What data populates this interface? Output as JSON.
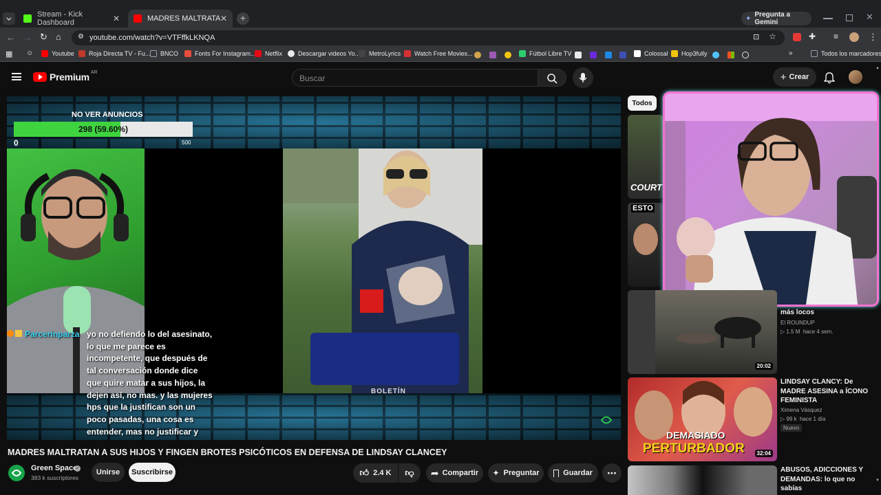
{
  "browser": {
    "tabs": [
      {
        "title": "Stream - Kick Dashboard",
        "active": false,
        "favicon_color": "#53fc18"
      },
      {
        "title": "MADRES MALTRATAN A SUS H",
        "active": true,
        "favicon_color": "#ff0000"
      }
    ],
    "gemini_label": "Pregunta a Gemini",
    "url": "youtube.com/watch?v=VTFffkLKNQA",
    "bookmarks": [
      {
        "label": "Youtube",
        "icon": "youtube-icon",
        "color": "#ff0000"
      },
      {
        "label": "Roja Directa TV - Fu...",
        "icon": "rojadirecta-icon",
        "color": "#c0392b"
      },
      {
        "label": "BNCO",
        "icon": "folder-icon",
        "color": "#9aa0a6"
      },
      {
        "label": "Fonts For Instagram...",
        "icon": "fonts-icon",
        "color": "#e74c3c"
      },
      {
        "label": "Netflix",
        "icon": "netflix-icon",
        "color": "#e50914"
      },
      {
        "label": "Descargar videos Yo...",
        "icon": "download-icon",
        "color": "#e8eaed"
      },
      {
        "label": "MetroLyrics",
        "icon": "metrolyrics-icon",
        "color": "#222222"
      },
      {
        "label": "Watch Free Movies...",
        "icon": "movies-icon",
        "color": "#d63031"
      },
      {
        "label": "Fútbol Libre TV",
        "icon": "futbol-icon",
        "color": "#2ecc71"
      },
      {
        "label": "Colossal",
        "icon": "colossal-icon",
        "color": "#ffffff"
      },
      {
        "label": "Hop3fully",
        "icon": "hop3fully-icon",
        "color": "#f1c40f"
      }
    ],
    "all_bookmarks_label": "Todos los marcadores"
  },
  "youtube": {
    "logo_text": "Premium",
    "region": "AR",
    "search_placeholder": "Buscar",
    "create_label": "Crear"
  },
  "stream_overlay": {
    "goal_title": "NO VER ANUNCIOS",
    "goal_value": "298 (59.60%)",
    "goal_fraction": 0.596,
    "goal_min": "0",
    "goal_max": "500",
    "chat_user": "Parcerinparza",
    "chat_message": "yo no defiendo lo del asesinato, lo que me parece es incompetente, que después de tal conversación donde dice que quire matar a sus hijos, la dejen así, no mas. y las mujeres hps que la justifican son un poco pasadas, una cosa es entender, mas no justificar y actuar con base a lo que hizo. entender, comprender no es justificar.",
    "lower_text": "BOLETÍN"
  },
  "video": {
    "title": "MADRES MALTRATAN A SUS HIJOS Y FINGEN BROTES PSICÓTICOS EN DEFENSA DE LINDSAY CLANCEY",
    "channel": "Green Space",
    "subscribers": "383 k suscriptores",
    "join_label": "Unirse",
    "subscribe_label": "Suscribirse",
    "likes": "2.4 K",
    "share_label": "Compartir",
    "ask_label": "Preguntar",
    "save_label": "Guardar"
  },
  "sidebar": {
    "chip_all": "Todos",
    "rec_partial_title": "más locos",
    "recommendations": [
      {
        "title": "",
        "channel": "El ROUNDUP",
        "views": "1.5 M",
        "age": "hace 4 sem.",
        "duration": "20:02",
        "thumb_text": ""
      },
      {
        "title": "LINDSAY CLANCY: De MADRE ASESINA a ÍCONO FEMINISTA",
        "channel": "Ximena Vásquez",
        "views": "99 k",
        "age": "hace 1 día",
        "badge": "Nuevo",
        "duration": "32:04",
        "thumb_text_1": "DEMASIADO",
        "thumb_text_2": "PERTURBADOR"
      },
      {
        "title": "ABUSOS, ADICCIONES Y DEMANDAS: lo que no sabías",
        "channel": "",
        "views": "",
        "age": "",
        "duration": ""
      }
    ],
    "thumb_labels": [
      "COURT",
      "ESTO"
    ]
  }
}
